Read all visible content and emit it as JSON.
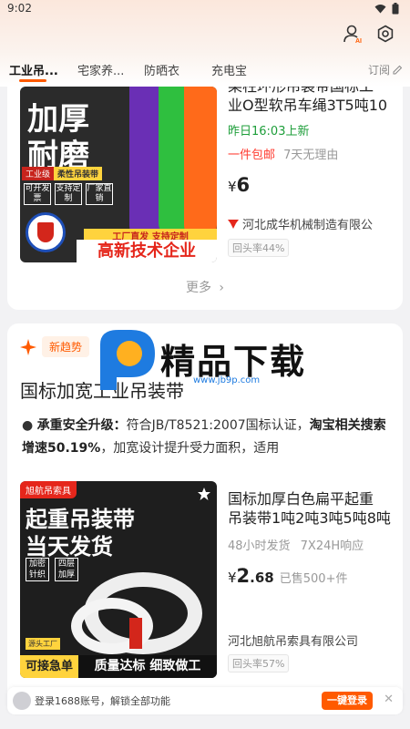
{
  "status": {
    "time": "9:02"
  },
  "tabs": [
    {
      "label": "工业吊..."
    },
    {
      "label": "宅家养..."
    },
    {
      "label": "防晒衣"
    },
    {
      "label": "充电宝"
    }
  ],
  "subscribe_label": "订阅",
  "card1": {
    "title_line1": "某柱环形吊装带国标工",
    "title_line2": "业O型软吊车绳3T5吨10",
    "updated": "昨日16:03上新",
    "shipping": "一件包邮",
    "returns": "7天无理由",
    "currency": "¥",
    "price": "6",
    "shop": "河北成华机械制造有限公",
    "repeat_rate": "回头率44%",
    "more_label": "更多",
    "image": {
      "headline1": "加厚",
      "headline2": "耐磨",
      "tag1": "工业级",
      "tag2": "柔性吊装带",
      "chip1": "可开发票",
      "chip2": "支持定制",
      "chip3": "厂家直销",
      "strip": "工厂直发 支持定制",
      "banner": "高新技术企业"
    }
  },
  "card2": {
    "trend_label": "新趋势",
    "section_title": "国标加宽工业吊装带",
    "bullet_title": "承重安全升级：",
    "bullet_text1": "符合JB/T8521:2007国标认证，",
    "bullet_bold2": "淘宝相关搜索增速50.19%",
    "bullet_text2": "，加宽设计提升受力面积，适用",
    "title_line1": "国标加厚白色扁平起重",
    "title_line2": "吊装带1吨2吨3吨5吨8吨",
    "shipping": "48小时发货",
    "response": "7X24H响应",
    "currency": "¥",
    "price_int": "2",
    "price_dec": ".68",
    "sold": "已售500+件",
    "shop": "河北旭航吊索具有限公司",
    "repeat_rate": "回头率57%",
    "image": {
      "brand": "旭航吊索具",
      "headline1": "起重吊装带",
      "headline2": "当天发货",
      "chip1": "加密针织",
      "chip2": "四层加厚",
      "footer_left": "可接急单",
      "footer_right": "质量达标 细致做工",
      "source": "源头工厂"
    }
  },
  "watermark": {
    "text": "精品下载",
    "url": "www.jb9p.com"
  },
  "login": {
    "text": "登录1688账号，解锁全部功能",
    "button": "一键登录"
  },
  "colors": {
    "accent": "#ff5a00",
    "price_red": "#ff3b30",
    "green": "#1e9e3a"
  }
}
